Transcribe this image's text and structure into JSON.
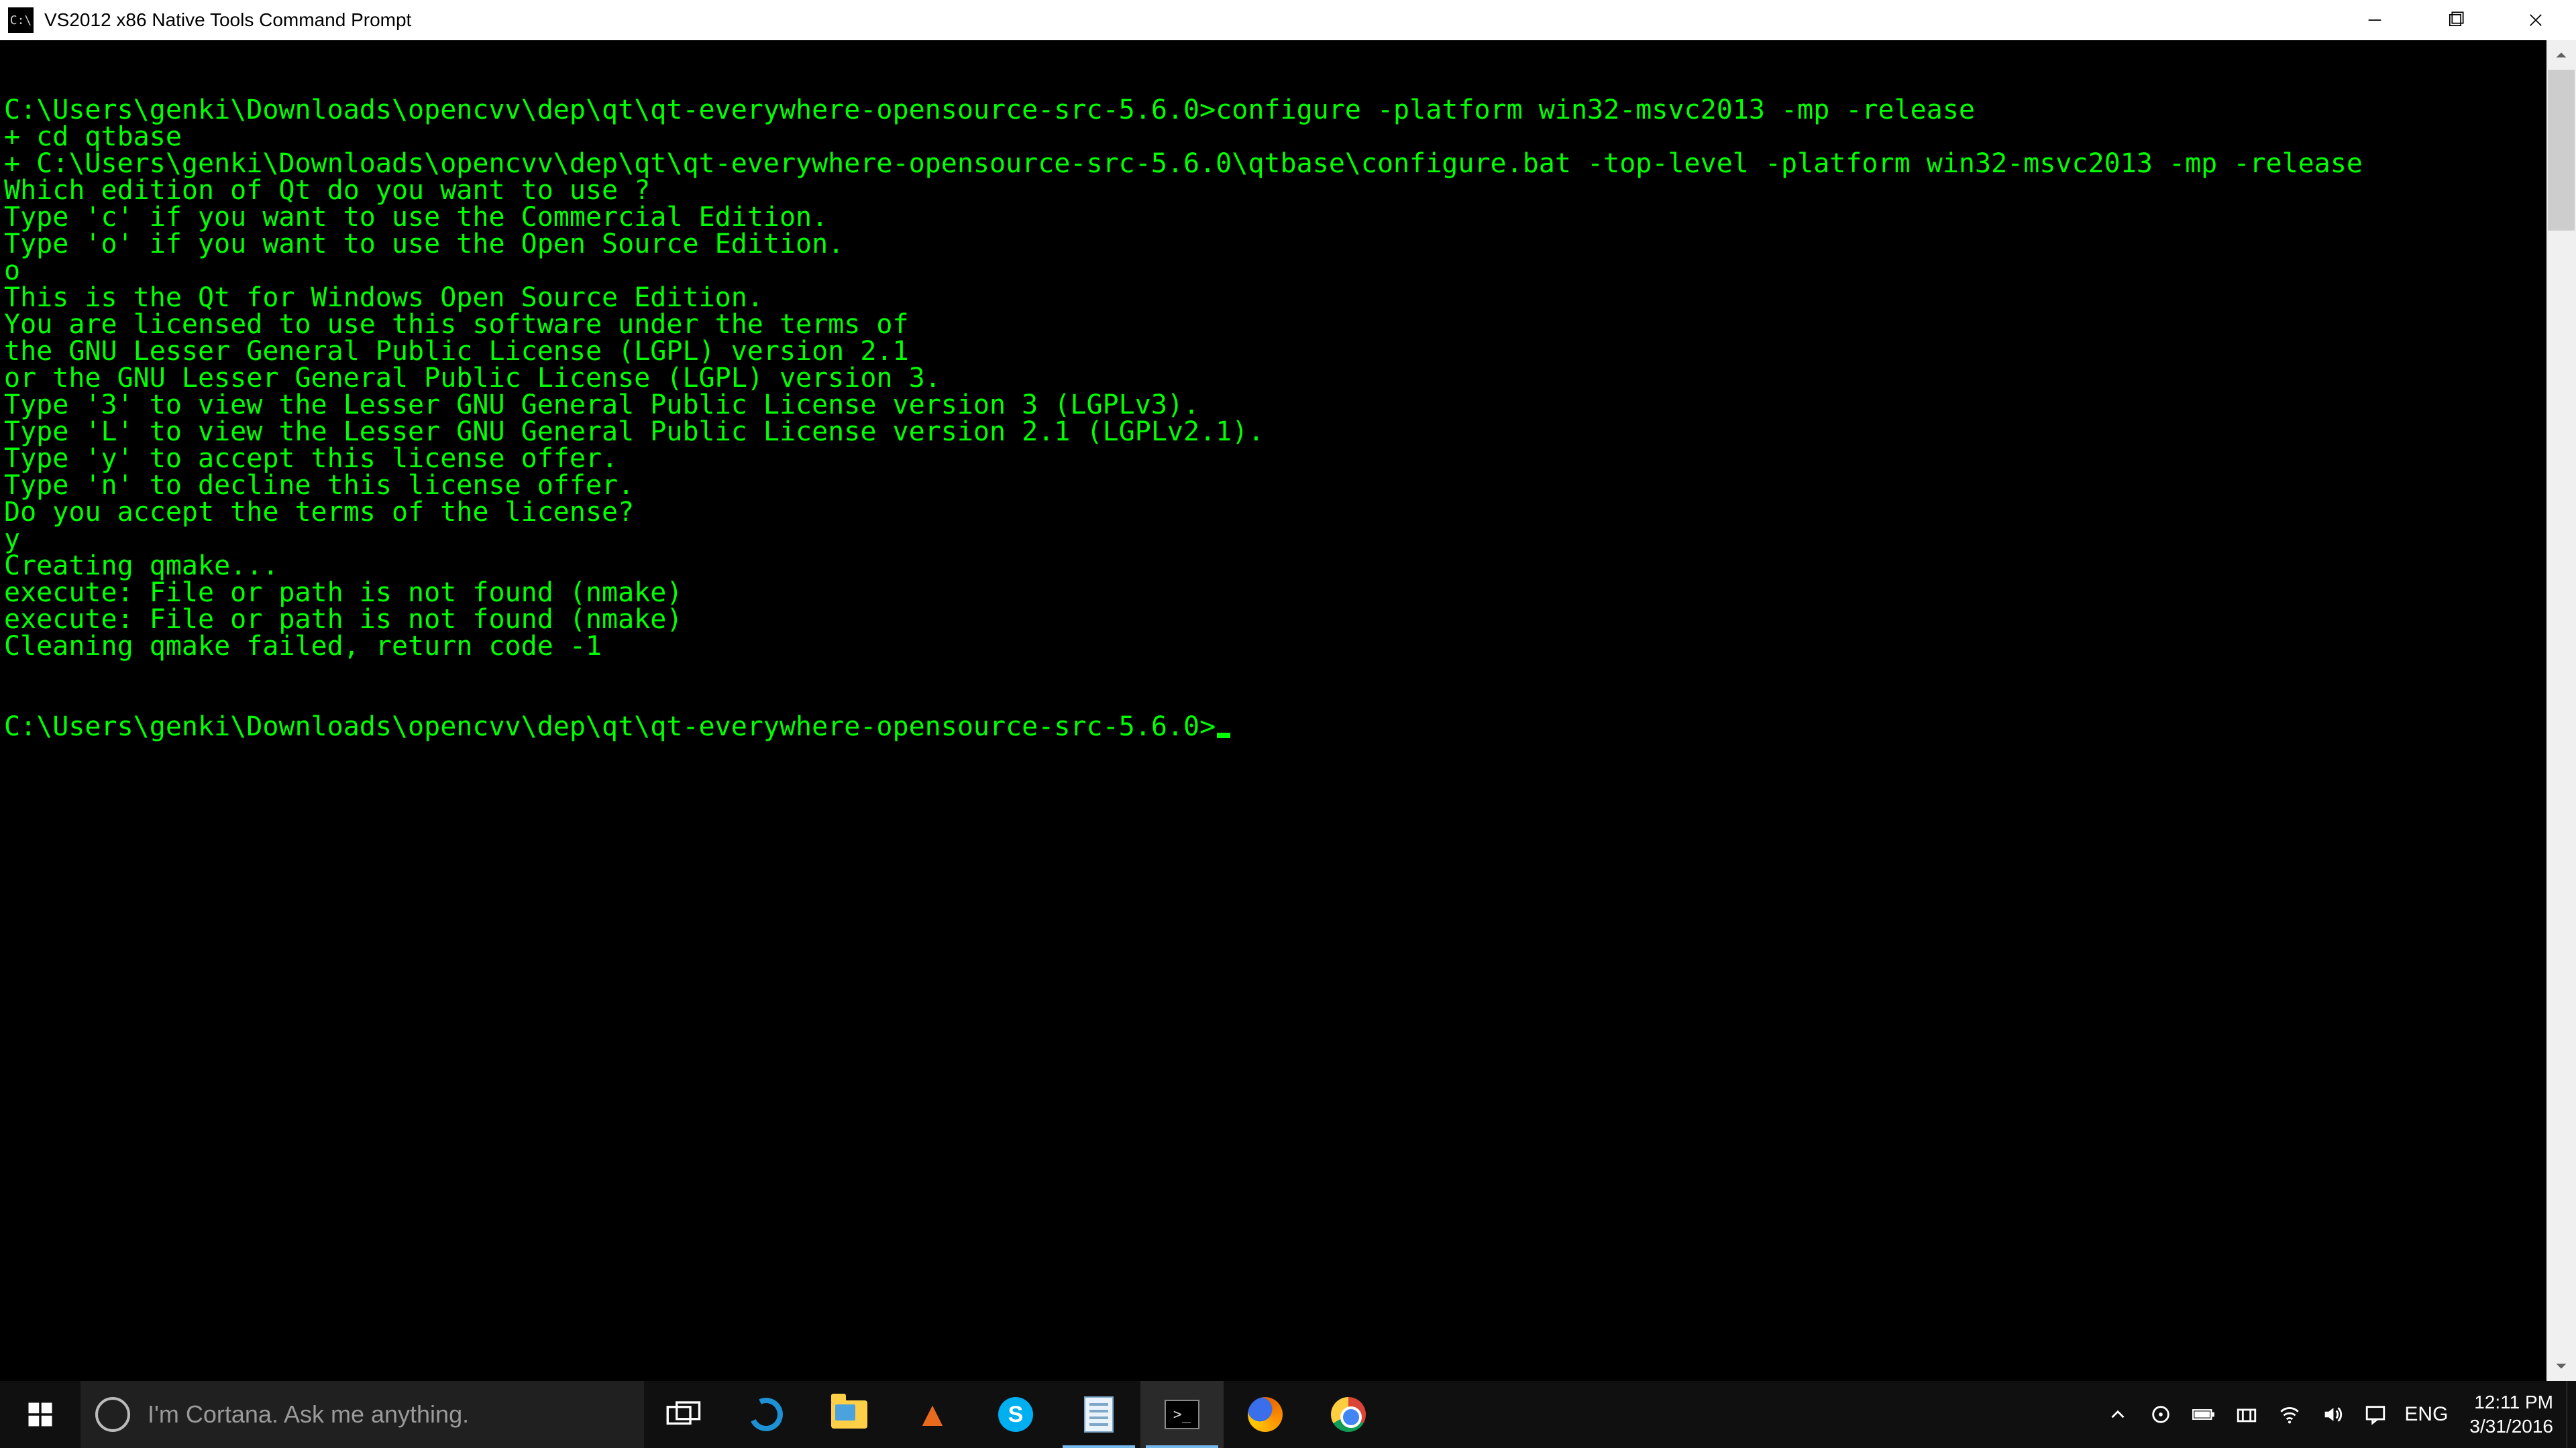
{
  "window": {
    "icon_label": "C:\\",
    "title": "VS2012 x86 Native Tools Command Prompt"
  },
  "terminal": {
    "lines": [
      "",
      "C:\\Users\\genki\\Downloads\\opencvv\\dep\\qt\\qt-everywhere-opensource-src-5.6.0>configure -platform win32-msvc2013 -mp -release",
      "+ cd qtbase",
      "+ C:\\Users\\genki\\Downloads\\opencvv\\dep\\qt\\qt-everywhere-opensource-src-5.6.0\\qtbase\\configure.bat -top-level -platform win32-msvc2013 -mp -release",
      "Which edition of Qt do you want to use ?",
      "Type 'c' if you want to use the Commercial Edition.",
      "Type 'o' if you want to use the Open Source Edition.",
      "o",
      "",
      "This is the Qt for Windows Open Source Edition.",
      "",
      "You are licensed to use this software under the terms of",
      "the GNU Lesser General Public License (LGPL) version 2.1",
      "or the GNU Lesser General Public License (LGPL) version 3.",
      "",
      "Type '3' to view the Lesser GNU General Public License version 3 (LGPLv3).",
      "Type 'L' to view the Lesser GNU General Public License version 2.1 (LGPLv2.1).",
      "Type 'y' to accept this license offer.",
      "Type 'n' to decline this license offer.",
      "",
      "Do you accept the terms of the license?",
      "y",
      "Creating qmake...",
      "execute: File or path is not found (nmake)",
      "execute: File or path is not found (nmake)",
      "Cleaning qmake failed, return code -1",
      "",
      ""
    ],
    "prompt": "C:\\Users\\genki\\Downloads\\opencvv\\dep\\qt\\qt-everywhere-opensource-src-5.6.0>"
  },
  "taskbar": {
    "cortana_placeholder": "I'm Cortana. Ask me anything.",
    "apps": [
      {
        "name": "edge"
      },
      {
        "name": "file-explorer"
      },
      {
        "name": "matlab"
      },
      {
        "name": "skype"
      },
      {
        "name": "notepad"
      },
      {
        "name": "cmd",
        "active": true
      },
      {
        "name": "firefox"
      },
      {
        "name": "chrome"
      }
    ],
    "lang": "ENG",
    "time": "12:11 PM",
    "date": "3/31/2016"
  }
}
